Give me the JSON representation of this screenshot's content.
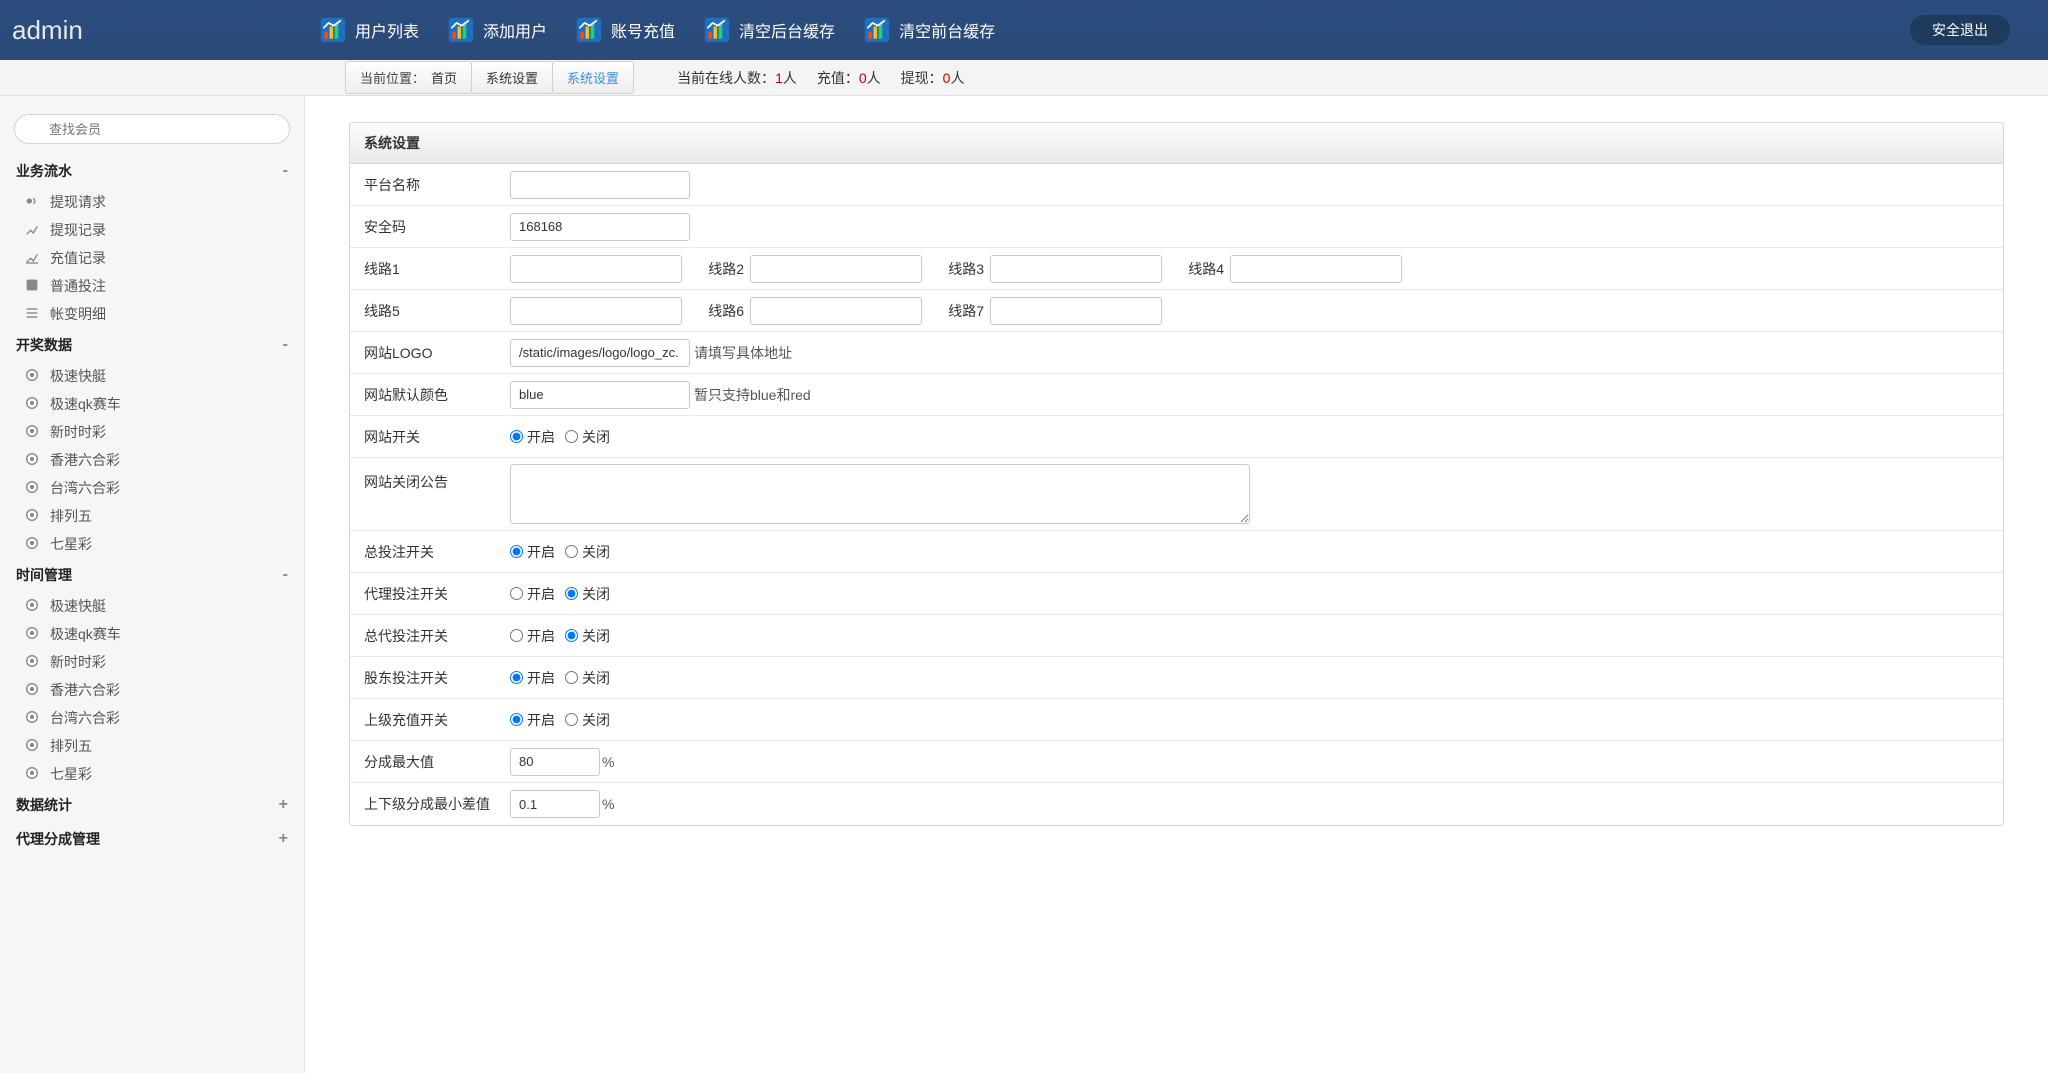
{
  "brand": "admin",
  "topnav": [
    {
      "label": "用户列表"
    },
    {
      "label": "添加用户"
    },
    {
      "label": "账号充值"
    },
    {
      "label": "清空后台缓存"
    },
    {
      "label": "清空前台缓存"
    }
  ],
  "logout_label": "安全退出",
  "breadcrumb": {
    "label": "当前位置：",
    "items": [
      "首页",
      "系统设置",
      "系统设置"
    ]
  },
  "stats": {
    "online_label": "当前在线人数：",
    "online_count": "1",
    "online_unit": "人",
    "recharge_label": "充值：",
    "recharge_count": "0",
    "recharge_unit": "人",
    "withdraw_label": "提现：",
    "withdraw_count": "0",
    "withdraw_unit": "人"
  },
  "search": {
    "placeholder": "查找会员"
  },
  "sidebar": [
    {
      "title": "业务流水",
      "toggle": "-",
      "items": [
        "提现请求",
        "提现记录",
        "充值记录",
        "普通投注",
        "帐变明细"
      ]
    },
    {
      "title": "开奖数据",
      "toggle": "-",
      "items": [
        "极速快艇",
        "极速qk赛车",
        "新时时彩",
        "香港六合彩",
        "台湾六合彩",
        "排列五",
        "七星彩"
      ]
    },
    {
      "title": "时间管理",
      "toggle": "-",
      "items": [
        "极速快艇",
        "极速qk赛车",
        "新时时彩",
        "香港六合彩",
        "台湾六合彩",
        "排列五",
        "七星彩"
      ]
    },
    {
      "title": "数据统计",
      "toggle": "+",
      "items": []
    },
    {
      "title": "代理分成管理",
      "toggle": "+",
      "items": []
    }
  ],
  "panel": {
    "title": "系统设置"
  },
  "form": {
    "platform_name": {
      "label": "平台名称",
      "value": ""
    },
    "security_code": {
      "label": "安全码",
      "value": "168168"
    },
    "lines1": {
      "first_label": "线路1",
      "pairs": [
        {
          "label": "线路1",
          "value": ""
        },
        {
          "label": "线路2",
          "value": ""
        },
        {
          "label": "线路3",
          "value": ""
        },
        {
          "label": "线路4",
          "value": ""
        }
      ]
    },
    "lines2": {
      "first_label": "线路5",
      "pairs": [
        {
          "label": "线路5",
          "value": ""
        },
        {
          "label": "线路6",
          "value": ""
        },
        {
          "label": "线路7",
          "value": ""
        }
      ]
    },
    "logo": {
      "label": "网站LOGO",
      "value": "/static/images/logo/logo_zc.",
      "hint": "请填写具体地址"
    },
    "default_color": {
      "label": "网站默认颜色",
      "value": "blue",
      "hint": "暂只支持blue和red"
    },
    "site_switch": {
      "label": "网站开关",
      "on": "开启",
      "off": "关闭",
      "value": "on"
    },
    "close_notice": {
      "label": "网站关闭公告",
      "value": ""
    },
    "total_bet_switch": {
      "label": "总投注开关",
      "on": "开启",
      "off": "关闭",
      "value": "on"
    },
    "agent_bet_switch": {
      "label": "代理投注开关",
      "on": "开启",
      "off": "关闭",
      "value": "off"
    },
    "master_bet_switch": {
      "label": "总代投注开关",
      "on": "开启",
      "off": "关闭",
      "value": "off"
    },
    "shareholder_bet_switch": {
      "label": "股东投注开关",
      "on": "开启",
      "off": "关闭",
      "value": "on"
    },
    "superior_recharge_switch": {
      "label": "上级充值开关",
      "on": "开启",
      "off": "关闭",
      "value": "on"
    },
    "split_max": {
      "label": "分成最大值",
      "value": "80",
      "unit": "%"
    },
    "split_min_diff": {
      "label": "上下级分成最小差值",
      "value": "0.1",
      "unit": "%"
    }
  }
}
